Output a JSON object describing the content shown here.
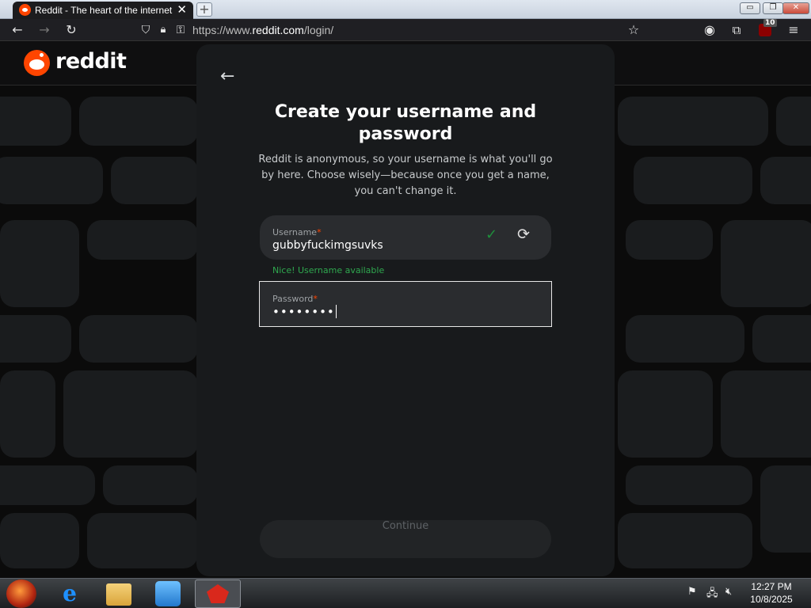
{
  "browser": {
    "tab_title": "Reddit - The heart of the internet",
    "tab_close": "✕",
    "new_tab": "+",
    "url_prefix": "https://www.",
    "url_domain": "reddit.com",
    "url_path": "/login/",
    "ublock_count": "10",
    "window_buttons": {
      "minimize": "▭",
      "restore": "❐",
      "close": "✕"
    }
  },
  "header": {
    "logo_text": "reddit"
  },
  "signup": {
    "title": "Create your username and password",
    "description": "Reddit is anonymous, so your username is what you'll go by here. Choose wisely—because once you get a name, you can't change it.",
    "username": {
      "label": "Username",
      "required_mark": "*",
      "value": "gubbyfuckimgsuvks",
      "status": "Nice! Username available"
    },
    "password": {
      "label": "Password",
      "required_mark": "*",
      "value": "••••••••"
    },
    "continue_label": "Continue"
  },
  "taskbar": {
    "time": "12:27 PM",
    "date": "10/8/2025"
  },
  "colors": {
    "reddit_orange": "#ff4500",
    "available_green": "#2fa84f",
    "modal_bg": "#181a1c"
  }
}
